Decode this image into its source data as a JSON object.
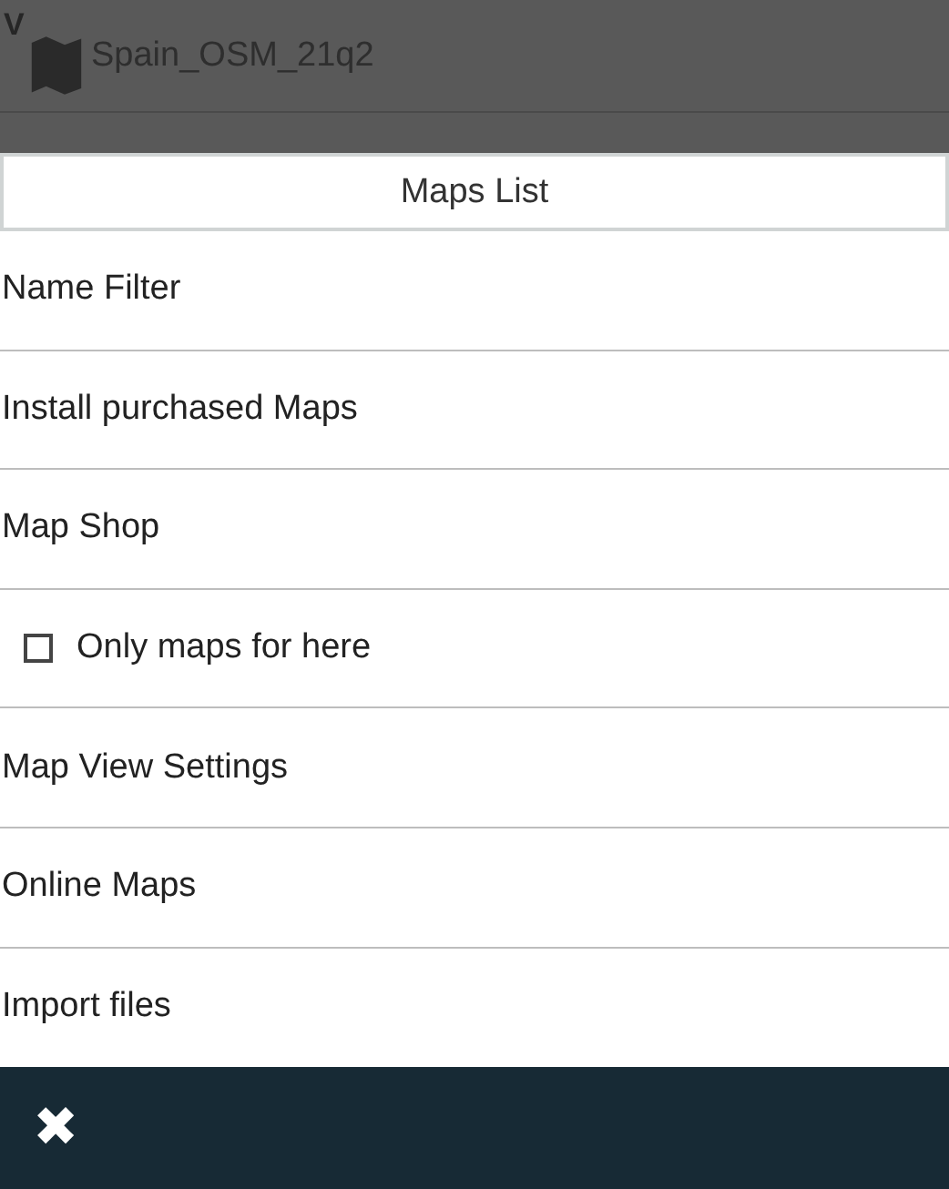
{
  "background_list": {
    "section_letter": "V",
    "item": "Spain_OSM_21q2"
  },
  "menu": {
    "title": "Maps List",
    "items": [
      {
        "kind": "action",
        "label": "Name Filter"
      },
      {
        "kind": "action",
        "label": "Install purchased Maps"
      },
      {
        "kind": "action",
        "label": "Map Shop"
      },
      {
        "kind": "checkbox",
        "label": "Only maps for here",
        "checked": false
      },
      {
        "kind": "action",
        "label": "Map View Settings"
      },
      {
        "kind": "action",
        "label": "Online Maps"
      },
      {
        "kind": "action",
        "label": "Import files"
      }
    ]
  },
  "bottom_bar": {
    "close": "✖"
  }
}
